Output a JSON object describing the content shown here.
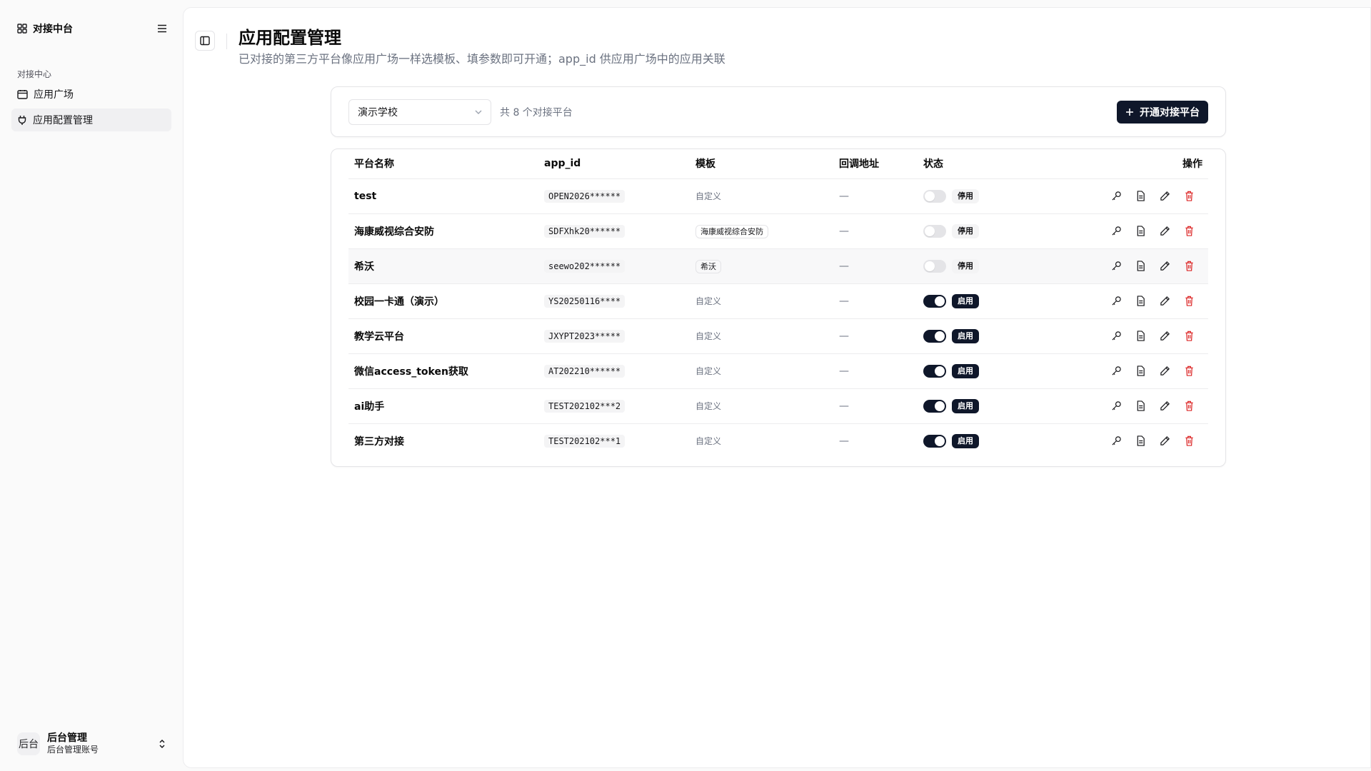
{
  "sidebar": {
    "brand": "对接中台",
    "brand_icon": "grid-icon",
    "group_label": "对接中心",
    "items": [
      {
        "label": "应用广场",
        "icon": "calendar-icon",
        "active": false
      },
      {
        "label": "应用配置管理",
        "icon": "plug-icon",
        "active": true
      }
    ],
    "user": {
      "avatar_text": "后台",
      "name": "后台管理",
      "sub": "后台管理账号"
    }
  },
  "header": {
    "title": "应用配置管理",
    "description": "已对接的第三方平台像应用广场一样选模板、填参数即可开通；app_id 供应用广场中的应用关联"
  },
  "filter": {
    "school": "演示学校",
    "count_text": "共 8 个对接平台",
    "add_button": "开通对接平台"
  },
  "table": {
    "columns": [
      "平台名称",
      "app_id",
      "模板",
      "回调地址",
      "状态",
      "操作"
    ],
    "rows": [
      {
        "name": "test",
        "app_id": "OPEN2026******",
        "template": "自定义",
        "template_style": "text",
        "callback": "—",
        "enabled": false,
        "status": "停用"
      },
      {
        "name": "海康威视综合安防",
        "app_id": "SDFXhk20******",
        "template": "海康威视综合安防",
        "template_style": "badge",
        "callback": "—",
        "enabled": false,
        "status": "停用"
      },
      {
        "name": "希沃",
        "app_id": "seewo202******",
        "template": "希沃",
        "template_style": "badge",
        "callback": "—",
        "enabled": false,
        "status": "停用"
      },
      {
        "name": "校园一卡通（演示）",
        "app_id": "YS20250116****",
        "template": "自定义",
        "template_style": "text",
        "callback": "—",
        "enabled": true,
        "status": "启用"
      },
      {
        "name": "教学云平台",
        "app_id": "JXYPT2023*****",
        "template": "自定义",
        "template_style": "text",
        "callback": "—",
        "enabled": true,
        "status": "启用"
      },
      {
        "name": "微信access_token获取",
        "app_id": "AT202210******",
        "template": "自定义",
        "template_style": "text",
        "callback": "—",
        "enabled": true,
        "status": "启用"
      },
      {
        "name": "ai助手",
        "app_id": "TEST202102***2",
        "template": "自定义",
        "template_style": "text",
        "callback": "—",
        "enabled": true,
        "status": "启用"
      },
      {
        "name": "第三方对接",
        "app_id": "TEST202102***1",
        "template": "自定义",
        "template_style": "text",
        "callback": "—",
        "enabled": true,
        "status": "启用"
      }
    ],
    "row_actions": [
      "key-icon",
      "document-icon",
      "pencil-icon",
      "trash-icon"
    ]
  },
  "colors": {
    "primary": "#0f172a",
    "danger": "#dc2626",
    "muted": "#6b7280"
  }
}
